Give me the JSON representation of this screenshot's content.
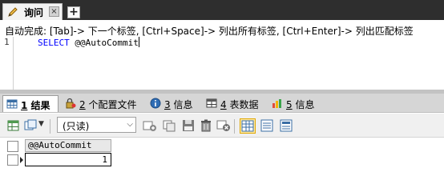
{
  "tabs": {
    "query_label": "询问",
    "close_glyph": "×",
    "add_glyph": "+"
  },
  "editor": {
    "hint": "自动完成: [Tab]-> 下一个标签, [Ctrl+Space]-> 列出所有标签, [Ctrl+Enter]-> 列出匹配标签",
    "line_number": "1",
    "keyword": "SELECT",
    "argument": "@@AutoCommit"
  },
  "result_tabs": [
    {
      "num": "1",
      "label": "结果"
    },
    {
      "num": "2",
      "label": "个配置文件"
    },
    {
      "num": "3",
      "label": "信息"
    },
    {
      "num": "4",
      "label": "表数据"
    },
    {
      "num": "5",
      "label": "信息"
    }
  ],
  "toolbar": {
    "readonly_value": "(只读)"
  },
  "grid": {
    "columns": [
      "@@AutoCommit"
    ],
    "rows": [
      [
        "1"
      ]
    ]
  },
  "colors": {
    "tabbar": "#2e2e2e",
    "keyword": "#0000ff",
    "panel": "#d6d6d6"
  }
}
